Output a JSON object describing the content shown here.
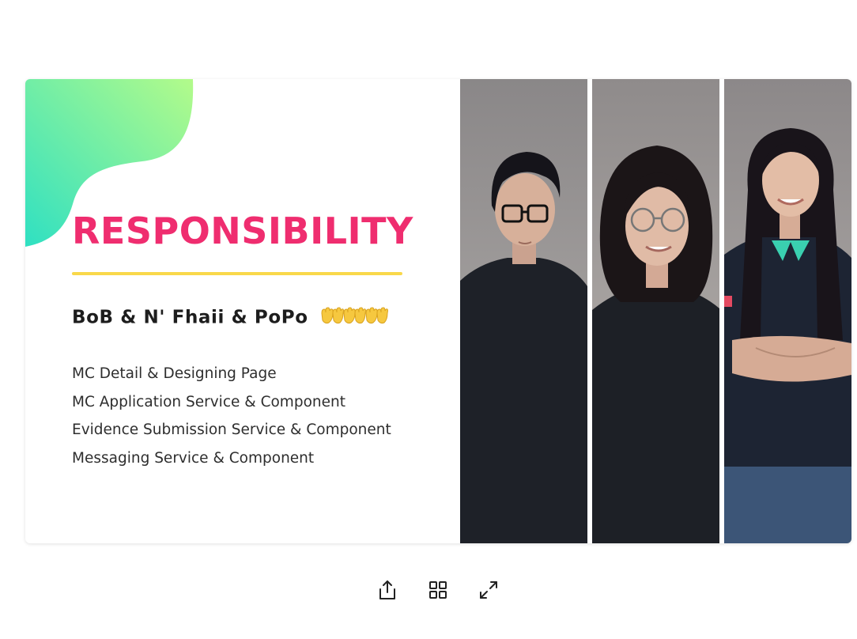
{
  "slide": {
    "title": "RESPONSIBILITY",
    "names": "BoB & N' Fhaii & PoPo",
    "hands_emoji": "🤲🤲🤲",
    "responsibilities": [
      "MC Detail & Designing Page",
      "MC Application Service & Component",
      "Evidence Submission Service & Component",
      "Messaging Service & Component"
    ],
    "colors": {
      "title": "#ef2d6f",
      "rule": "#f9d84a",
      "blob_start": "#2fe0c2",
      "blob_end": "#b3fb8a"
    },
    "photos": [
      "person-photo-1",
      "person-photo-2",
      "person-photo-3"
    ]
  },
  "toolbar": {
    "items": [
      "share-icon",
      "grid-view-icon",
      "fullscreen-icon"
    ]
  }
}
